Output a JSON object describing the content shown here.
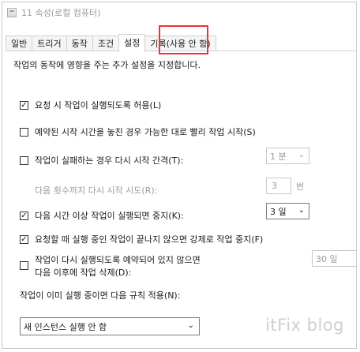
{
  "window": {
    "title": "11 속성(로컬 컴퓨터)",
    "app_icon": "task-scheduler-icon"
  },
  "tabs": [
    {
      "label": "일반",
      "active": false
    },
    {
      "label": "트리거",
      "active": false
    },
    {
      "label": "동작",
      "active": false
    },
    {
      "label": "조건",
      "active": false
    },
    {
      "label": "설정",
      "active": true
    },
    {
      "label": "기록(사용 안 함)",
      "active": false
    }
  ],
  "highlight_color": "#e33333",
  "settings": {
    "description": "작업의 동작에 영향을 주는 추가 설정을 지정합니다.",
    "allow_on_demand": {
      "label": "요청 시 작업이 실행되도록 허용(L)",
      "checked": true
    },
    "run_after_missed": {
      "label": "예약된 시작 시간을 놓친 경우 가능한 대로 빨리 작업 시작(S)",
      "checked": false
    },
    "restart_on_failure": {
      "label": "작업이 실패하는 경우 다시 시작 간격(T):",
      "checked": false,
      "interval_value": "1 분"
    },
    "restart_attempts": {
      "label": "다음 횟수까지 다시 시작 시도(R):",
      "value": "3",
      "unit": "번"
    },
    "stop_if_runs_longer": {
      "label": "다음 시간 이상 작업이 실행되면 중지(K):",
      "checked": true,
      "value": "3 일"
    },
    "force_stop": {
      "label": "요청할 때 실행 중인 작업이 끝나지 않으면 강제로 작업 중지(F)",
      "checked": true
    },
    "delete_if_not_scheduled": {
      "label_line1": "작업이 다시 실행되도록 예약되어 있지 않으면",
      "label_line2": "다음 이후에 작업 삭제(D):",
      "checked": false,
      "value": "30 일"
    },
    "rule_label": "작업이 이미 실행 중이면 다음 규칙 적용(N):",
    "rule_value": "새 인스턴스 실행 안 함"
  },
  "watermark": "itFix blog"
}
